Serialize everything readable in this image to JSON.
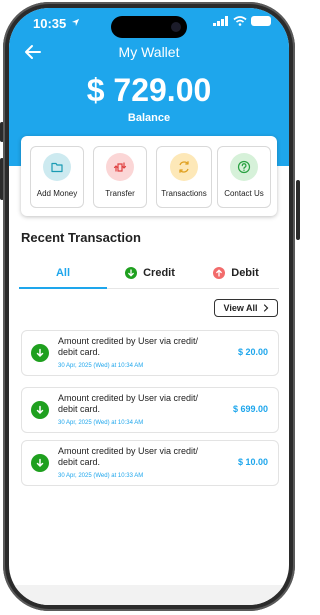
{
  "status_bar": {
    "time": "10:35"
  },
  "header": {
    "title": "My Wallet",
    "balance": "$ 729.00",
    "balance_label": "Balance"
  },
  "actions": [
    {
      "label": "Add Money",
      "icon": "folder-icon",
      "bg": "#cdeaf0",
      "fg": "#1a9bb3"
    },
    {
      "label": "Transfer",
      "icon": "transfer-icon",
      "bg": "#fbd6d6",
      "fg": "#e04040"
    },
    {
      "label": "Transactions",
      "icon": "exchange-icon",
      "bg": "#fde8b8",
      "fg": "#e0a020"
    },
    {
      "label": "Contact Us",
      "icon": "help-icon",
      "bg": "#d6f1d9",
      "fg": "#28a040"
    }
  ],
  "section_title": "Recent Transaction",
  "tabs": [
    {
      "label": "All"
    },
    {
      "label": "Credit"
    },
    {
      "label": "Debit"
    }
  ],
  "view_all_label": "View All",
  "transactions": [
    {
      "description": "Amount credited by User via credit/ debit card.",
      "timestamp": "30 Apr, 2025 (Wed) at 10:34 AM",
      "amount": "$ 20.00"
    },
    {
      "description": "Amount credited by User via credit/ debit card.",
      "timestamp": "30 Apr, 2025 (Wed) at 10:34 AM",
      "amount": "$ 699.00"
    },
    {
      "description": "Amount credited by User via credit/ debit card.",
      "timestamp": "30 Apr, 2025 (Wed) at 10:33 AM",
      "amount": "$ 10.00"
    }
  ],
  "colors": {
    "accent": "#1ea6ec",
    "credit": "#1fa01f",
    "debit": "#f26b6b"
  }
}
